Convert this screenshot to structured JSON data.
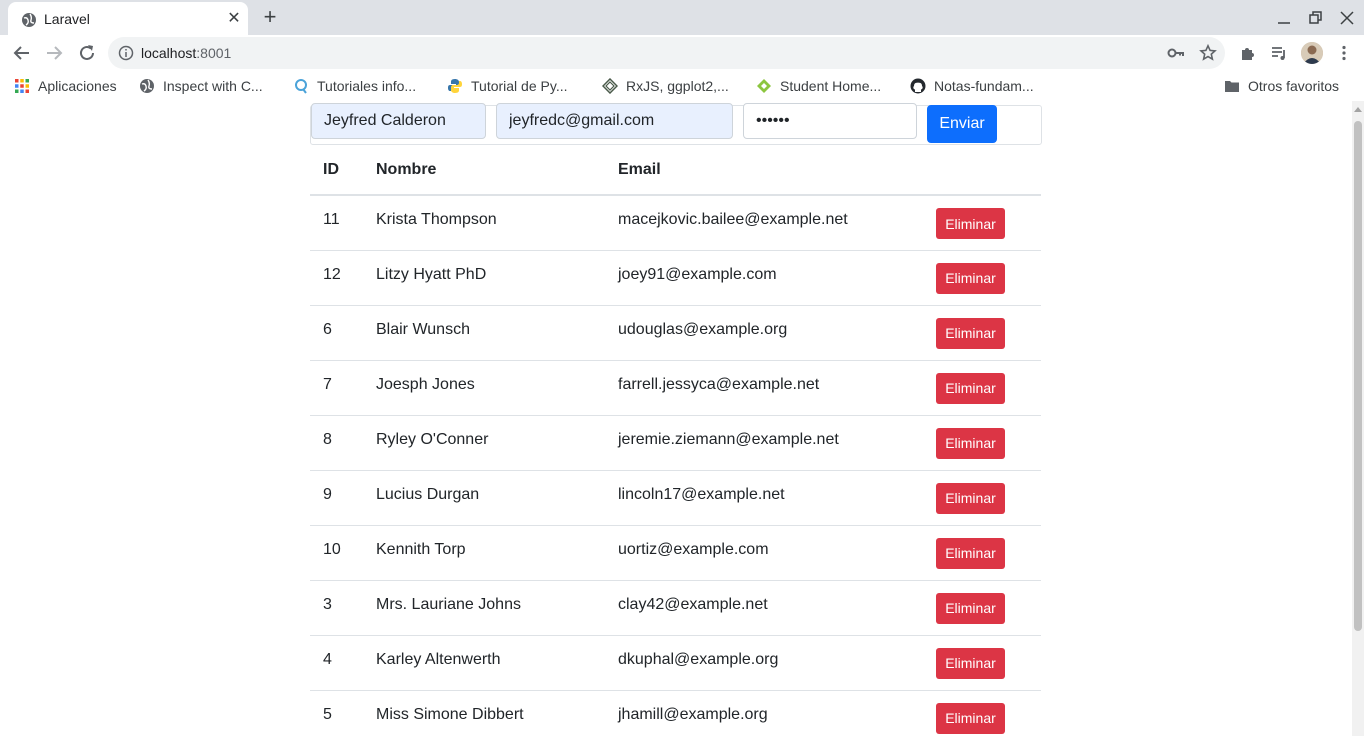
{
  "browser": {
    "tab_title": "Laravel",
    "url_host": "localhost",
    "url_port": ":8001",
    "bookmarks": [
      {
        "label": "Aplicaciones",
        "icon": "apps-grid-icon"
      },
      {
        "label": "Inspect with C...",
        "icon": "globe-icon"
      },
      {
        "label": "Tutoriales info...",
        "icon": "q-logo-icon"
      },
      {
        "label": "Tutorial de Py...",
        "icon": "python-icon"
      },
      {
        "label": "RxJS, ggplot2,...",
        "icon": "diamond-icon"
      },
      {
        "label": "Student Home...",
        "icon": "leaf-icon"
      },
      {
        "label": "Notas-fundam...",
        "icon": "github-icon"
      }
    ],
    "other_bookmarks": "Otros favoritos"
  },
  "form": {
    "name_value": "Jeyfred Calderon",
    "email_value": "jeyfredc@gmail.com",
    "password_mask": "••••••",
    "submit_label": "Enviar"
  },
  "table": {
    "headers": {
      "id": "ID",
      "name": "Nombre",
      "email": "Email"
    },
    "delete_label": "Eliminar",
    "rows": [
      {
        "id": "11",
        "name": "Krista Thompson",
        "email": "macejkovic.bailee@example.net"
      },
      {
        "id": "12",
        "name": "Litzy Hyatt PhD",
        "email": "joey91@example.com"
      },
      {
        "id": "6",
        "name": "Blair Wunsch",
        "email": "udouglas@example.org"
      },
      {
        "id": "7",
        "name": "Joesph Jones",
        "email": "farrell.jessyca@example.net"
      },
      {
        "id": "8",
        "name": "Ryley O'Conner",
        "email": "jeremie.ziemann@example.net"
      },
      {
        "id": "9",
        "name": "Lucius Durgan",
        "email": "lincoln17@example.net"
      },
      {
        "id": "10",
        "name": "Kennith Torp",
        "email": "uortiz@example.com"
      },
      {
        "id": "3",
        "name": "Mrs. Lauriane Johns",
        "email": "clay42@example.net"
      },
      {
        "id": "4",
        "name": "Karley Altenwerth",
        "email": "dkuphal@example.org"
      },
      {
        "id": "5",
        "name": "Miss Simone Dibbert",
        "email": "jhamill@example.org"
      }
    ]
  },
  "colors": {
    "primary": "#0d6efd",
    "danger": "#dc3545",
    "autofill": "#e8f0fe"
  }
}
